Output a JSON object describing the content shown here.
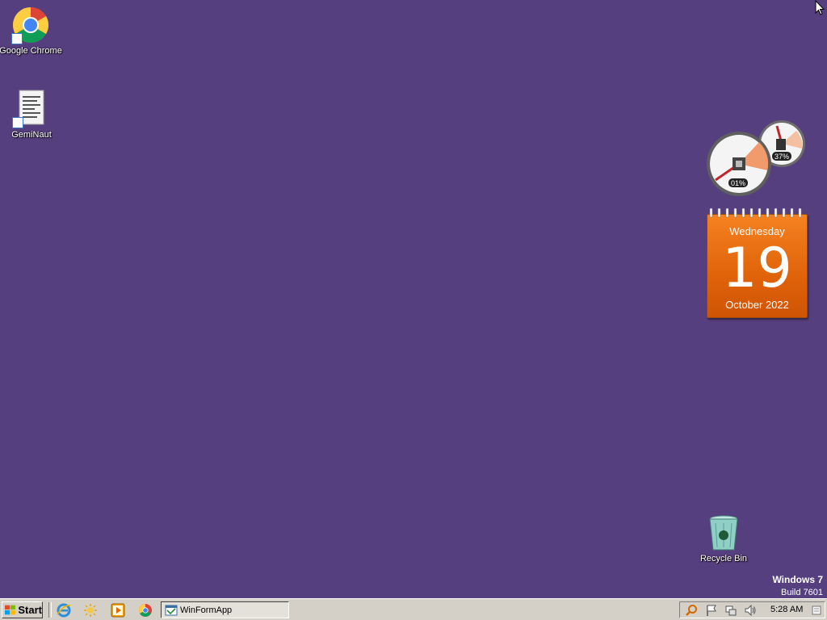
{
  "desktop": {
    "background_color": "#563f7e",
    "icons": [
      {
        "label": "Google Chrome",
        "icon": "chrome-icon"
      },
      {
        "label": "GemiNaut",
        "icon": "document-shortcut-icon"
      },
      {
        "label": "Recycle Bin",
        "icon": "recycle-bin-icon"
      }
    ],
    "gadgets": {
      "cpu_meter": {
        "cpu_percent": "01%",
        "memory_percent": "37%"
      },
      "calendar": {
        "weekday": "Wednesday",
        "day": "19",
        "month_year": "October 2022",
        "color": "#e8690f"
      }
    },
    "watermark": {
      "name": "Windows 7",
      "build": "Build 7601"
    }
  },
  "taskbar": {
    "start_label": "Start",
    "quick_launch": [
      "internet-explorer-icon",
      "explorer-folder-icon",
      "media-player-icon",
      "chrome-icon"
    ],
    "tasks": [
      {
        "label": "WinFormApp",
        "icon": "app-window-icon"
      }
    ],
    "tray": {
      "icons": [
        "search-icon",
        "flag-icon",
        "network-icon",
        "volume-icon",
        "notification-icon"
      ],
      "clock": "5:28 AM"
    }
  }
}
